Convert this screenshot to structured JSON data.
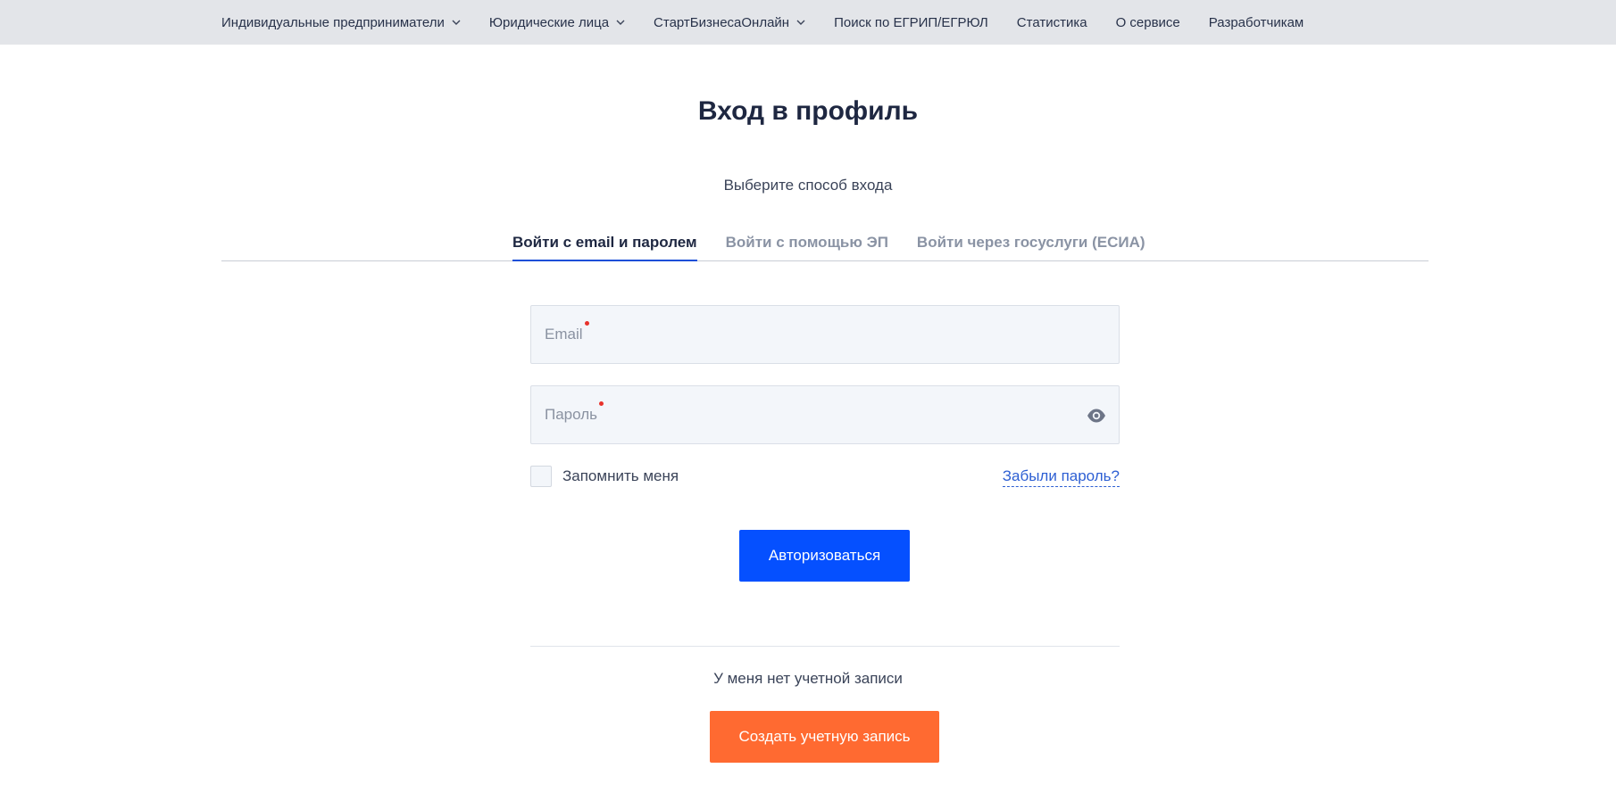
{
  "nav": {
    "items": [
      {
        "label": "Индивидуальные предприниматели",
        "has_dropdown": true
      },
      {
        "label": "Юридические лица",
        "has_dropdown": true
      },
      {
        "label": "СтартБизнесаОнлайн",
        "has_dropdown": true
      },
      {
        "label": "Поиск по ЕГРИП/ЕГРЮЛ",
        "has_dropdown": false
      },
      {
        "label": "Статистика",
        "has_dropdown": false
      },
      {
        "label": "О сервисе",
        "has_dropdown": false
      },
      {
        "label": "Разработчикам",
        "has_dropdown": false
      }
    ]
  },
  "page": {
    "title": "Вход в профиль",
    "subtitle": "Выберите способ входа"
  },
  "tabs": [
    {
      "label": "Войти с email и паролем",
      "active": true
    },
    {
      "label": "Войти с помощью ЭП",
      "active": false
    },
    {
      "label": "Войти через госуслуги (ЕСИА)",
      "active": false
    }
  ],
  "form": {
    "email": {
      "placeholder": "Email",
      "value": "",
      "required": true
    },
    "password": {
      "placeholder": "Пароль",
      "value": "",
      "required": true,
      "icon": "eye-icon"
    },
    "remember_label": "Запомнить меня",
    "remember_checked": false,
    "forgot_label": "Забыли пароль?",
    "submit_label": "Авторизоваться"
  },
  "signup": {
    "prompt": "У меня нет учетной записи",
    "button_label": "Создать учетную запись"
  },
  "colors": {
    "primary": "#0550ff",
    "accent": "#ff6a31",
    "link": "#2d5fd3",
    "required": "#e8322b",
    "nav_bg": "#e3e5e9"
  }
}
